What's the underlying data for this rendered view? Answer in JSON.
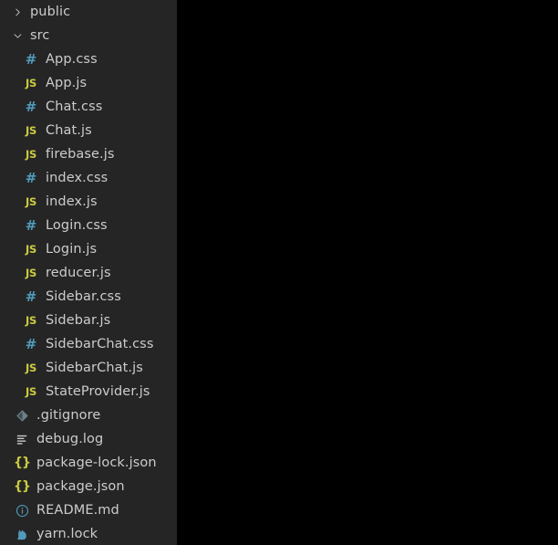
{
  "window": {
    "background": "#000000",
    "explorer_background": "#252526",
    "text_color": "#cccccc"
  },
  "colors": {
    "js_icon": "#cbcb41",
    "css_icon": "#519aba",
    "json_icon": "#cbcb41",
    "git_icon": "#6d8086",
    "log_icon": "#c5c5c5",
    "markdown_icon": "#519aba",
    "yarn_icon": "#519aba",
    "chevron": "#c5c5c5"
  },
  "explorer": {
    "items": [
      {
        "label": "public",
        "type": "folder",
        "icon": "chevron-right-icon",
        "expanded": false,
        "depth": 1
      },
      {
        "label": "src",
        "type": "folder",
        "icon": "chevron-down-icon",
        "expanded": true,
        "depth": 1
      },
      {
        "label": "App.css",
        "type": "file",
        "icon": "css-icon",
        "glyph": "#",
        "color": "#519aba",
        "depth": 2
      },
      {
        "label": "App.js",
        "type": "file",
        "icon": "js-icon",
        "glyph": "JS",
        "color": "#cbcb41",
        "depth": 2
      },
      {
        "label": "Chat.css",
        "type": "file",
        "icon": "css-icon",
        "glyph": "#",
        "color": "#519aba",
        "depth": 2
      },
      {
        "label": "Chat.js",
        "type": "file",
        "icon": "js-icon",
        "glyph": "JS",
        "color": "#cbcb41",
        "depth": 2
      },
      {
        "label": "firebase.js",
        "type": "file",
        "icon": "js-icon",
        "glyph": "JS",
        "color": "#cbcb41",
        "depth": 2
      },
      {
        "label": "index.css",
        "type": "file",
        "icon": "css-icon",
        "glyph": "#",
        "color": "#519aba",
        "depth": 2
      },
      {
        "label": "index.js",
        "type": "file",
        "icon": "js-icon",
        "glyph": "JS",
        "color": "#cbcb41",
        "depth": 2
      },
      {
        "label": "Login.css",
        "type": "file",
        "icon": "css-icon",
        "glyph": "#",
        "color": "#519aba",
        "depth": 2
      },
      {
        "label": "Login.js",
        "type": "file",
        "icon": "js-icon",
        "glyph": "JS",
        "color": "#cbcb41",
        "depth": 2
      },
      {
        "label": "reducer.js",
        "type": "file",
        "icon": "js-icon",
        "glyph": "JS",
        "color": "#cbcb41",
        "depth": 2
      },
      {
        "label": "Sidebar.css",
        "type": "file",
        "icon": "css-icon",
        "glyph": "#",
        "color": "#519aba",
        "depth": 2
      },
      {
        "label": "Sidebar.js",
        "type": "file",
        "icon": "js-icon",
        "glyph": "JS",
        "color": "#cbcb41",
        "depth": 2
      },
      {
        "label": "SidebarChat.css",
        "type": "file",
        "icon": "css-icon",
        "glyph": "#",
        "color": "#519aba",
        "depth": 2
      },
      {
        "label": "SidebarChat.js",
        "type": "file",
        "icon": "js-icon",
        "glyph": "JS",
        "color": "#cbcb41",
        "depth": 2
      },
      {
        "label": "StateProvider.js",
        "type": "file",
        "icon": "js-icon",
        "glyph": "JS",
        "color": "#cbcb41",
        "depth": 2
      },
      {
        "label": ".gitignore",
        "type": "file",
        "icon": "git-icon",
        "glyph": "",
        "color": "#6d8086",
        "depth": 1
      },
      {
        "label": "debug.log",
        "type": "file",
        "icon": "log-icon",
        "glyph": "",
        "color": "#c5c5c5",
        "depth": 1
      },
      {
        "label": "package-lock.json",
        "type": "file",
        "icon": "json-icon",
        "glyph": "{}",
        "color": "#cbcb41",
        "depth": 1
      },
      {
        "label": "package.json",
        "type": "file",
        "icon": "json-icon",
        "glyph": "{}",
        "color": "#cbcb41",
        "depth": 1
      },
      {
        "label": "README.md",
        "type": "file",
        "icon": "markdown-info-icon",
        "glyph": "",
        "color": "#519aba",
        "depth": 1
      },
      {
        "label": "yarn.lock",
        "type": "file",
        "icon": "yarn-icon",
        "glyph": "",
        "color": "#519aba",
        "depth": 1
      }
    ]
  }
}
